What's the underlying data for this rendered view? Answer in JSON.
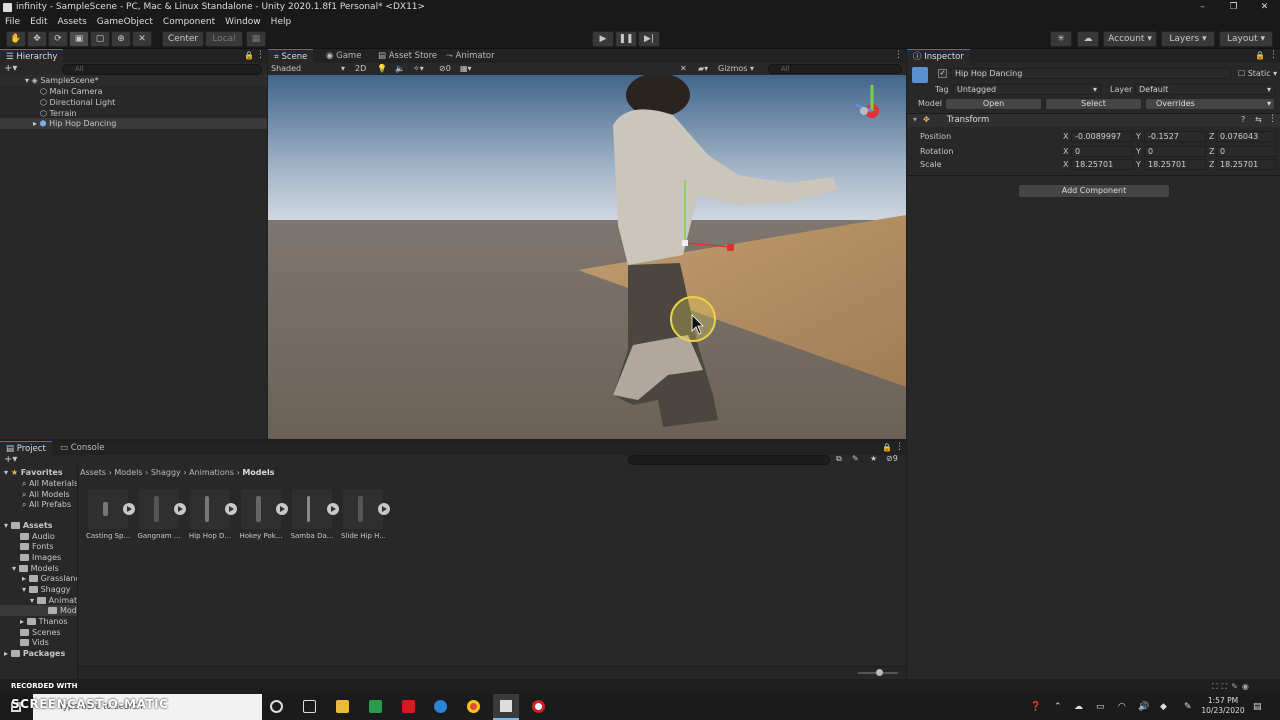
{
  "window": {
    "title": "infinity - SampleScene - PC, Mac & Linux Standalone - Unity 2020.1.8f1 Personal* <DX11>",
    "controls": [
      "–",
      "❐",
      "✕"
    ]
  },
  "menu": [
    "File",
    "Edit",
    "Assets",
    "GameObject",
    "Component",
    "Window",
    "Help"
  ],
  "toolbar": {
    "pivot": "Center",
    "space": "Local",
    "account": "Account",
    "layers": "Layers",
    "layout": "Layout"
  },
  "hierarchy": {
    "tab": "Hierarchy",
    "search_placeholder": "All",
    "scene": "SampleScene*",
    "items": [
      "Main Camera",
      "Directional Light",
      "Terrain",
      "Hip Hop Dancing"
    ]
  },
  "scene_view": {
    "tabs": [
      "Scene",
      "Game",
      "Asset Store",
      "Animator"
    ],
    "shading": "Shaded",
    "mode_2d": "2D",
    "hidden_count": "0",
    "gizmos": "Gizmos",
    "search_placeholder": "All"
  },
  "inspector": {
    "tab": "Inspector",
    "object_name": "Hip Hop Dancing",
    "static_label": "Static",
    "tag_label": "Tag",
    "tag_value": "Untagged",
    "layer_label": "Layer",
    "layer_value": "Default",
    "model_label": "Model",
    "open_button": "Open",
    "select_button": "Select",
    "overrides": "Overrides",
    "transform_title": "Transform",
    "position_label": "Position",
    "rotation_label": "Rotation",
    "scale_label": "Scale",
    "axis_x": "X",
    "axis_y": "Y",
    "axis_z": "Z",
    "position": {
      "x": "-0.0089997",
      "y": "-0.1527",
      "z": "0.076043"
    },
    "rotation": {
      "x": "0",
      "y": "0",
      "z": "0"
    },
    "scale": {
      "x": "18.25701",
      "y": "18.25701",
      "z": "18.25701"
    },
    "add_component": "Add Component"
  },
  "project": {
    "tabs": [
      "Project",
      "Console"
    ],
    "favorites_title": "Favorites",
    "favorites": [
      "All Materials",
      "All Models",
      "All Prefabs"
    ],
    "assets_title": "Assets",
    "tree": [
      "Audio",
      "Fonts",
      "Images",
      "Models",
      "Grassland",
      "Shaggy",
      "Animations",
      "Models",
      "Thanos",
      "Scenes",
      "Vids"
    ],
    "packages": "Packages",
    "breadcrumb": [
      "Assets",
      "Shaggy",
      "Animations",
      "Models"
    ],
    "breadcrumb_full": [
      "Assets",
      "Models",
      "Shaggy",
      "Animations",
      "Models"
    ],
    "hidden_count": "9",
    "assets": [
      "Casting Sp...",
      "Gangnam ...",
      "Hip Hop D...",
      "Hokey Pok...",
      "Samba Da...",
      "Slide Hip H..."
    ]
  },
  "taskbar": {
    "recorded_with": "RECORDED WITH",
    "brand": "SCREENCAST-O-MATIC",
    "search_placeholder": "Type here to search",
    "time": "1:57 PM",
    "date": "10/23/2020"
  },
  "colors": {
    "accent": "#3a79bb",
    "panel": "#282828",
    "dark": "#191919",
    "sky_top": "#4a6f92",
    "ground": "#7a6d5c",
    "sand": "#b08c60"
  }
}
